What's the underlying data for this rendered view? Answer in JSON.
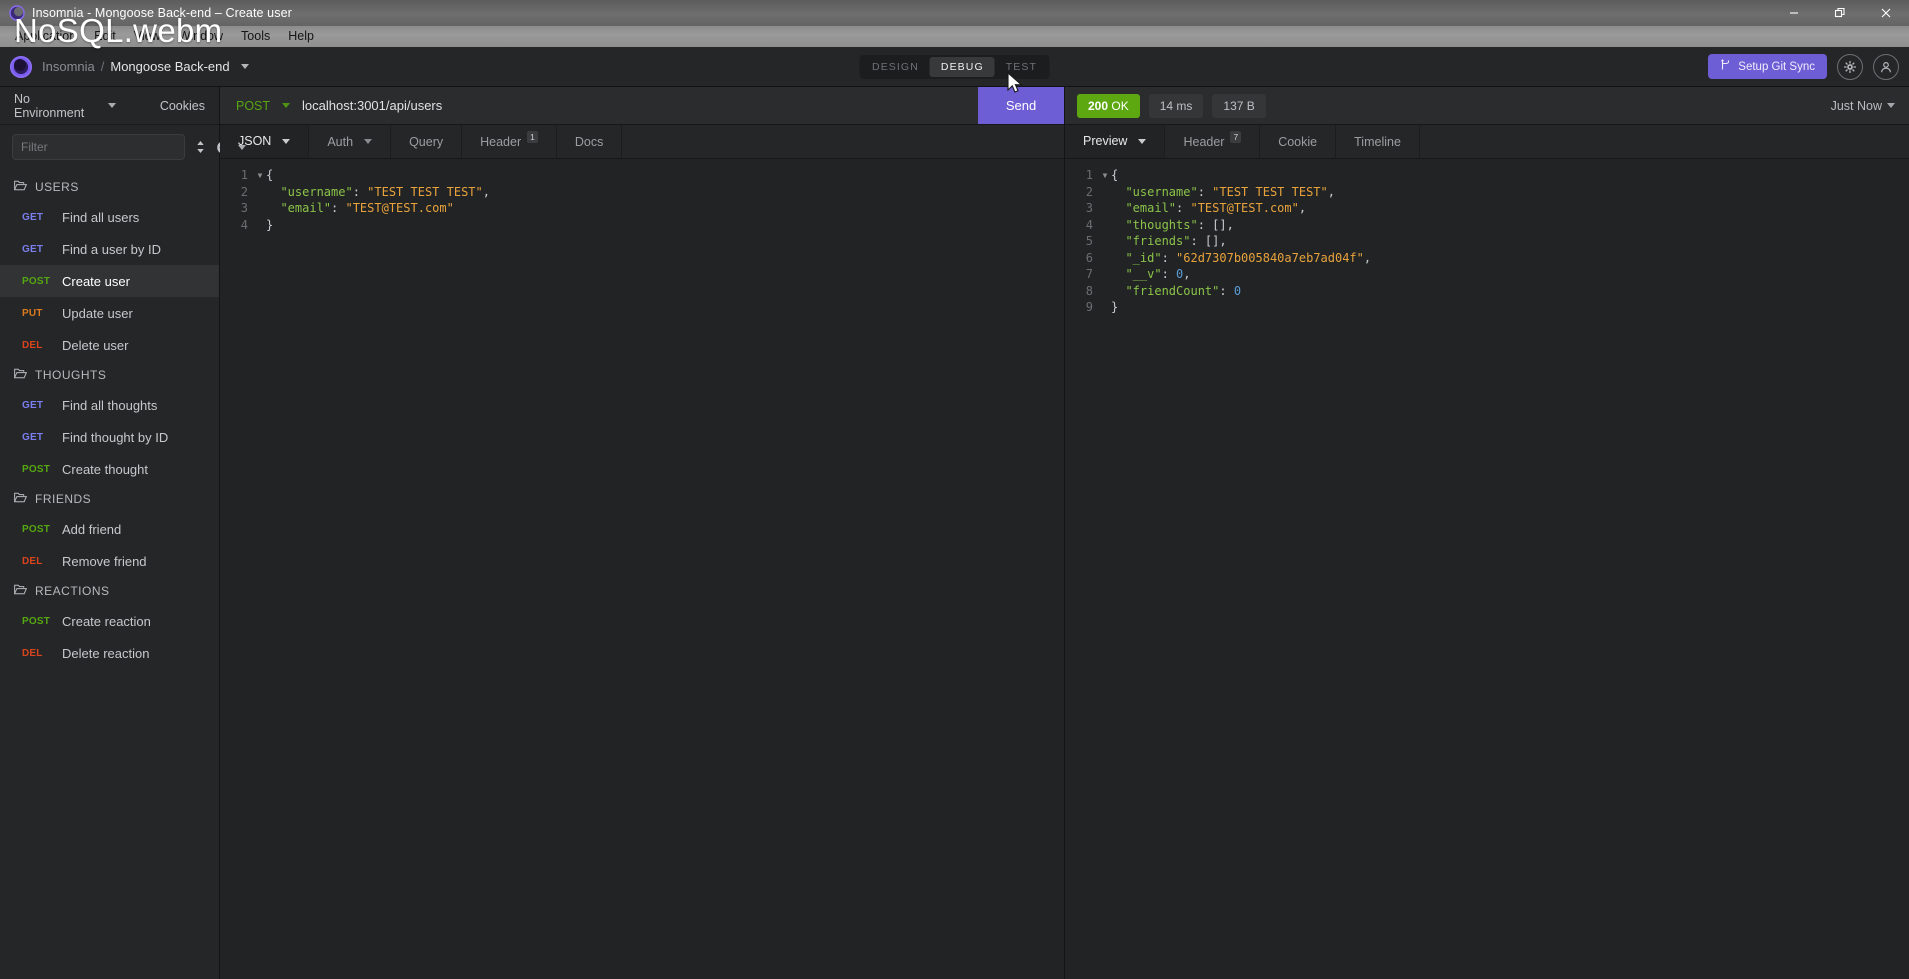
{
  "window": {
    "title": "Insomnia - Mongoose Back-end – Create user",
    "app_icon": "insomnia-logo-icon",
    "controls": {
      "minimize": "minimize-icon",
      "restore": "restore-icon",
      "close": "close-icon"
    }
  },
  "menubar": {
    "items": [
      "Application",
      "Edit",
      "View",
      "Window",
      "Tools",
      "Help"
    ]
  },
  "overlay": {
    "watermark": "NoSQL.webm"
  },
  "header": {
    "breadcrumb_app": "Insomnia",
    "breadcrumb_sep": "/",
    "breadcrumb_workspace": "Mongoose Back-end",
    "modes": [
      {
        "label": "DESIGN",
        "active": false
      },
      {
        "label": "DEBUG",
        "active": true
      },
      {
        "label": "TEST",
        "active": false
      }
    ],
    "git_sync_label": "Setup Git Sync",
    "git_icon": "git-branch-icon",
    "settings_icon": "gear-icon",
    "account_icon": "account-icon",
    "accent_color": "#6d5ed6"
  },
  "sidebar": {
    "environment_label": "No Environment",
    "cookies_label": "Cookies",
    "filter_placeholder": "Filter",
    "filter_value": "",
    "sort_icon": "sort-icon",
    "add_icon": "plus-circle-icon",
    "folder_icon": "folder-icon",
    "groups": [
      {
        "name": "USERS",
        "open": true,
        "requests": [
          {
            "method": "GET",
            "name": "Find all users",
            "selected": false
          },
          {
            "method": "GET",
            "name": "Find a user by ID",
            "selected": false
          },
          {
            "method": "POST",
            "name": "Create user",
            "selected": true
          },
          {
            "method": "PUT",
            "name": "Update user",
            "selected": false
          },
          {
            "method": "DEL",
            "name": "Delete user",
            "selected": false
          }
        ]
      },
      {
        "name": "THOUGHTS",
        "open": false,
        "requests": [
          {
            "method": "GET",
            "name": "Find all thoughts",
            "selected": false
          },
          {
            "method": "GET",
            "name": "Find thought by ID",
            "selected": false
          },
          {
            "method": "POST",
            "name": "Create thought",
            "selected": false
          }
        ]
      },
      {
        "name": "FRIENDS",
        "open": false,
        "requests": [
          {
            "method": "POST",
            "name": "Add friend",
            "selected": false
          },
          {
            "method": "DEL",
            "name": "Remove friend",
            "selected": false
          }
        ]
      },
      {
        "name": "REACTIONS",
        "open": false,
        "requests": [
          {
            "method": "POST",
            "name": "Create reaction",
            "selected": false
          },
          {
            "method": "DEL",
            "name": "Delete reaction",
            "selected": false
          }
        ]
      }
    ]
  },
  "request": {
    "method": "POST",
    "url": "localhost:3001/api/users",
    "send_label": "Send",
    "tabs": [
      {
        "label": "JSON",
        "active": true,
        "dropdown": true,
        "badge": ""
      },
      {
        "label": "Auth",
        "active": false,
        "dropdown": true,
        "badge": ""
      },
      {
        "label": "Query",
        "active": false,
        "dropdown": false,
        "badge": ""
      },
      {
        "label": "Header",
        "active": false,
        "dropdown": false,
        "badge": "1"
      },
      {
        "label": "Docs",
        "active": false,
        "dropdown": false,
        "badge": ""
      }
    ],
    "body_lines": [
      {
        "n": "1",
        "fold": "▾",
        "tokens": [
          {
            "t": "pun",
            "v": "{"
          }
        ]
      },
      {
        "n": "2",
        "fold": "",
        "tokens": [
          {
            "t": "key",
            "v": "  \"username\""
          },
          {
            "t": "pun",
            "v": ": "
          },
          {
            "t": "str",
            "v": "\"TEST TEST TEST\""
          },
          {
            "t": "pun",
            "v": ","
          }
        ]
      },
      {
        "n": "3",
        "fold": "",
        "tokens": [
          {
            "t": "key",
            "v": "  \"email\""
          },
          {
            "t": "pun",
            "v": ": "
          },
          {
            "t": "str",
            "v": "\"TEST@TEST.com\""
          }
        ]
      },
      {
        "n": "4",
        "fold": "",
        "tokens": [
          {
            "t": "pun",
            "v": "}"
          }
        ]
      }
    ]
  },
  "response": {
    "status_code": "200",
    "status_text": "OK",
    "status_color": "#5da811",
    "time": "14 ms",
    "size": "137 B",
    "history_label": "Just Now",
    "tabs": [
      {
        "label": "Preview",
        "active": true,
        "dropdown": true,
        "badge": ""
      },
      {
        "label": "Header",
        "active": false,
        "dropdown": false,
        "badge": "7"
      },
      {
        "label": "Cookie",
        "active": false,
        "dropdown": false,
        "badge": ""
      },
      {
        "label": "Timeline",
        "active": false,
        "dropdown": false,
        "badge": ""
      }
    ],
    "body_lines": [
      {
        "n": "1",
        "fold": "▾",
        "tokens": [
          {
            "t": "pun",
            "v": "{"
          }
        ]
      },
      {
        "n": "2",
        "fold": "",
        "tokens": [
          {
            "t": "key",
            "v": "  \"username\""
          },
          {
            "t": "pun",
            "v": ": "
          },
          {
            "t": "str",
            "v": "\"TEST TEST TEST\""
          },
          {
            "t": "pun",
            "v": ","
          }
        ]
      },
      {
        "n": "3",
        "fold": "",
        "tokens": [
          {
            "t": "key",
            "v": "  \"email\""
          },
          {
            "t": "pun",
            "v": ": "
          },
          {
            "t": "str",
            "v": "\"TEST@TEST.com\""
          },
          {
            "t": "pun",
            "v": ","
          }
        ]
      },
      {
        "n": "4",
        "fold": "",
        "tokens": [
          {
            "t": "key",
            "v": "  \"thoughts\""
          },
          {
            "t": "pun",
            "v": ": [],"
          }
        ]
      },
      {
        "n": "5",
        "fold": "",
        "tokens": [
          {
            "t": "key",
            "v": "  \"friends\""
          },
          {
            "t": "pun",
            "v": ": [],"
          }
        ]
      },
      {
        "n": "6",
        "fold": "",
        "tokens": [
          {
            "t": "key",
            "v": "  \"_id\""
          },
          {
            "t": "pun",
            "v": ": "
          },
          {
            "t": "str",
            "v": "\"62d7307b005840a7eb7ad04f\""
          },
          {
            "t": "pun",
            "v": ","
          }
        ]
      },
      {
        "n": "7",
        "fold": "",
        "tokens": [
          {
            "t": "key",
            "v": "  \"__v\""
          },
          {
            "t": "pun",
            "v": ": "
          },
          {
            "t": "num",
            "v": "0"
          },
          {
            "t": "pun",
            "v": ","
          }
        ]
      },
      {
        "n": "8",
        "fold": "",
        "tokens": [
          {
            "t": "key",
            "v": "  \"friendCount\""
          },
          {
            "t": "pun",
            "v": ": "
          },
          {
            "t": "num",
            "v": "0"
          }
        ]
      },
      {
        "n": "9",
        "fold": "",
        "tokens": [
          {
            "t": "pun",
            "v": "}"
          }
        ]
      }
    ]
  }
}
